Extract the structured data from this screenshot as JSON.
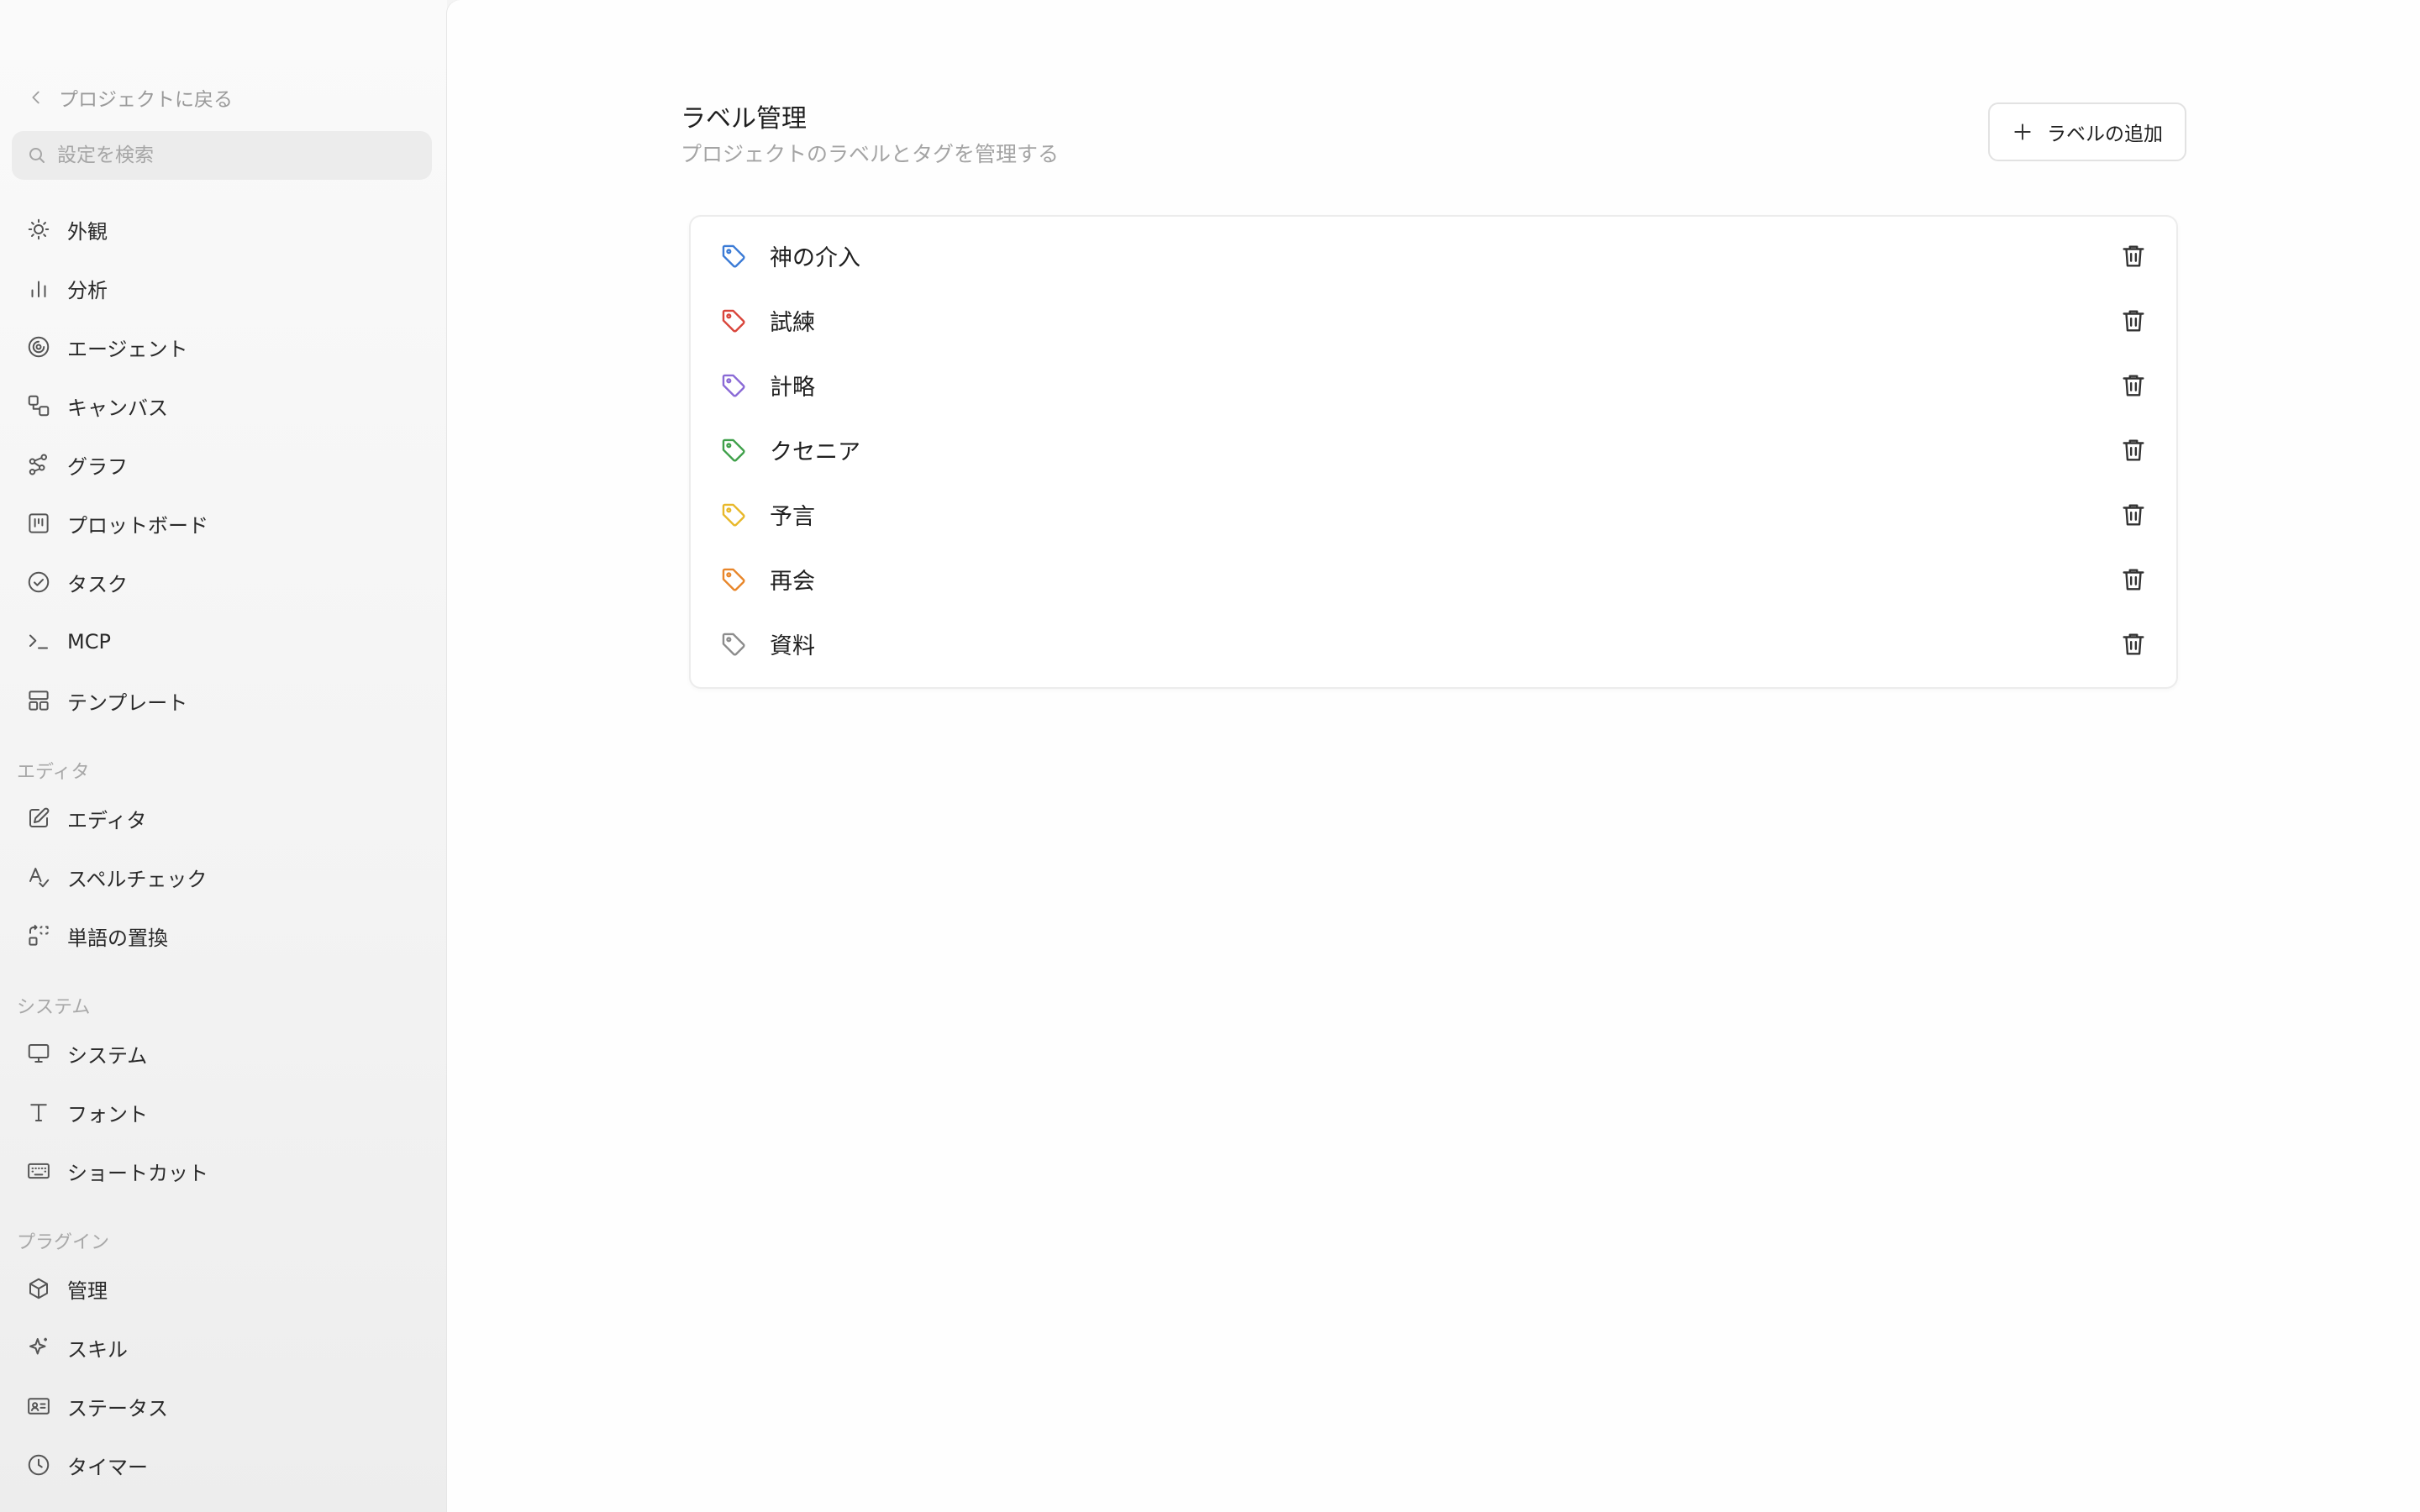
{
  "sidebar": {
    "back_label": "プロジェクトに戻る",
    "search_placeholder": "設定を検索",
    "items_main": [
      {
        "label": "外観",
        "icon": "sun-icon"
      },
      {
        "label": "分析",
        "icon": "bar-chart-icon"
      },
      {
        "label": "エージェント",
        "icon": "spiral-icon"
      },
      {
        "label": "キャンバス",
        "icon": "shapes-icon"
      },
      {
        "label": "グラフ",
        "icon": "graph-icon"
      },
      {
        "label": "プロットボード",
        "icon": "kanban-icon"
      },
      {
        "label": "タスク",
        "icon": "check-circle-icon"
      },
      {
        "label": "MCP",
        "icon": "terminal-icon"
      },
      {
        "label": "テンプレート",
        "icon": "layout-icon"
      }
    ],
    "section_editor": "エディタ",
    "items_editor": [
      {
        "label": "エディタ",
        "icon": "pencil-square-icon"
      },
      {
        "label": "スペルチェック",
        "icon": "spellcheck-icon"
      },
      {
        "label": "単語の置換",
        "icon": "replace-icon"
      }
    ],
    "section_system": "システム",
    "items_system": [
      {
        "label": "システム",
        "icon": "monitor-icon"
      },
      {
        "label": "フォント",
        "icon": "type-icon"
      },
      {
        "label": "ショートカット",
        "icon": "keyboard-icon"
      }
    ],
    "section_plugin": "プラグイン",
    "items_plugin": [
      {
        "label": "管理",
        "icon": "package-icon"
      },
      {
        "label": "スキル",
        "icon": "sparkle-icon"
      },
      {
        "label": "ステータス",
        "icon": "id-card-icon"
      },
      {
        "label": "タイマー",
        "icon": "clock-icon"
      }
    ]
  },
  "main": {
    "title": "ラベル管理",
    "subtitle": "プロジェクトのラベルとタグを管理する",
    "add_label": "ラベルの追加",
    "labels": [
      {
        "name": "神の介入",
        "color": "#3b7bd6"
      },
      {
        "name": "試練",
        "color": "#d9453b"
      },
      {
        "name": "計略",
        "color": "#8a6ad6"
      },
      {
        "name": "クセニア",
        "color": "#3fa04a"
      },
      {
        "name": "予言",
        "color": "#e8b82a"
      },
      {
        "name": "再会",
        "color": "#e8862a"
      },
      {
        "name": "資料",
        "color": "#8c8c8c"
      }
    ]
  }
}
